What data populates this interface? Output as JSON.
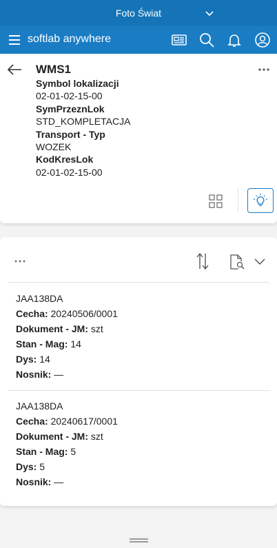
{
  "topbar": {
    "company": "Foto Świat"
  },
  "appbar": {
    "brand": "softlab anywhere"
  },
  "header": {
    "title": "WMS1",
    "fields": [
      {
        "label": "Symbol lokalizacji",
        "value": "02-01-02-15-00"
      },
      {
        "label": "SymPrzeznLok",
        "value": "STD_KOMPLETACJA"
      },
      {
        "label": "Transport - Typ",
        "value": "WOZEK"
      },
      {
        "label": "KodKresLok",
        "value": "02-01-02-15-00"
      }
    ]
  },
  "list": {
    "items": [
      {
        "code": "JAA138DA",
        "cecha_label": "Cecha:",
        "cecha": "20240506/0001",
        "jm_label": "Dokument - JM:",
        "jm": "szt",
        "stan_label": "Stan - Mag:",
        "stan": "14",
        "dys_label": "Dys:",
        "dys": "14",
        "nosnik_label": "Nosnik:",
        "nosnik": "—"
      },
      {
        "code": "JAA138DA",
        "cecha_label": "Cecha:",
        "cecha": "20240617/0001",
        "jm_label": "Dokument - JM:",
        "jm": "szt",
        "stan_label": "Stan - Mag:",
        "stan": "5",
        "dys_label": "Dys:",
        "dys": "5",
        "nosnik_label": "Nosnik:",
        "nosnik": "—"
      }
    ]
  },
  "colors": {
    "primary": "#1a7dc4",
    "topbar": "#1574b8",
    "background": "#f3f3f3"
  },
  "icons": [
    "chevron-down-icon",
    "menu-icon",
    "news-icon",
    "search-icon",
    "bell-icon",
    "user-icon",
    "back-arrow-icon",
    "more-icon",
    "tiles-icon",
    "lightbulb-icon",
    "sort-icon",
    "search-document-icon",
    "grip-icon"
  ]
}
